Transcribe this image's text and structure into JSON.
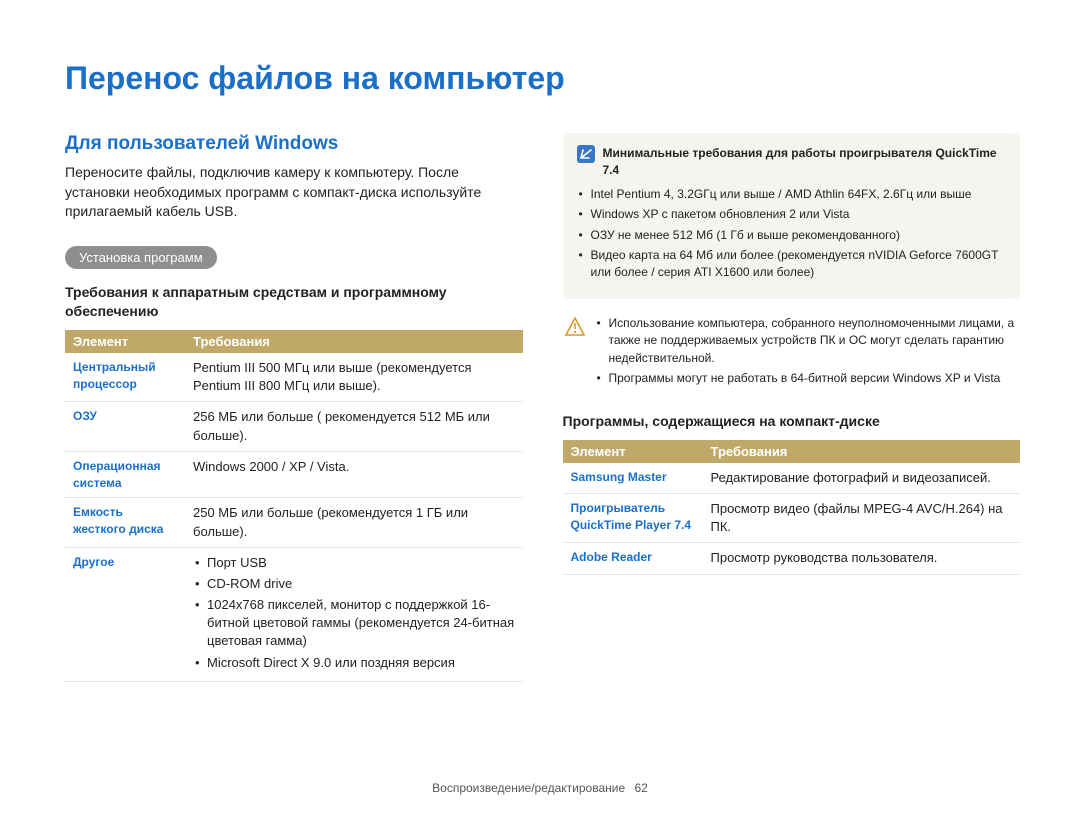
{
  "page_title": "Перенос файлов на компьютер",
  "left": {
    "section_title": "Для пользователей Windows",
    "intro": "Переносите файлы, подключив камеру к компьютеру. После установки необходимых программ с компакт-диска используйте прилагаемый кабель USB.",
    "pill": "Установка программ",
    "subhead": "Требования к аппаратным средствам и программному обеспечению",
    "table": {
      "head1": "Элемент",
      "head2": "Требования",
      "rows": [
        {
          "k": "Центральный процессор",
          "v": "Pentium III 500 МГц или выше (рекомендуется Pentium III 800 МГц или выше)."
        },
        {
          "k": "ОЗУ",
          "v": "256 МБ или больше ( рекомендуется 512 МБ или больше)."
        },
        {
          "k": "Операционная система",
          "v": "Windows 2000 / XP / Vista."
        },
        {
          "k": "Емкость жесткого диска",
          "v": "250 МБ или больше (рекомендуется 1 ГБ или больше)."
        }
      ],
      "other_key": "Другое",
      "other_items": [
        "Порт USB",
        "CD-ROM drive",
        "1024x768 пикселей, монитор с поддержкой 16-битной цветовой гаммы (рекомендуется 24-битная цветовая гамма)",
        "Microsoft Direct X 9.0 или поздняя версия"
      ]
    }
  },
  "right": {
    "note_title": "Минимальные требования для работы проигрывателя QuickTime 7.4",
    "note_items": [
      "Intel Pentium 4, 3.2GГц или выше / AMD Athlin 64FX, 2.6Гц или выше",
      "Windows XP с пакетом обновления 2 или Vista",
      "ОЗУ не менее 512 Мб (1 Гб и выше рекомендованного)",
      "Видео карта на 64 Мб или более (рекомендуется nVIDIA Geforce 7600GT или более / серия ATI X1600 или более)"
    ],
    "warn_items": [
      "Использование компьютера, собранного неуполномоченными лицами, а также не поддерживаемых устройств ПК и ОС могут сделать гарантию недействительной.",
      "Программы могут не работать в 64-битной версии Windows XP и Vista"
    ],
    "subhead": "Программы, содержащиеся на компакт-диске",
    "table": {
      "head1": "Элемент",
      "head2": "Требования",
      "rows": [
        {
          "k": "Samsung Master",
          "v": "Редактирование фотографий и видеозаписей."
        },
        {
          "k": "Проигрыватель QuickTime Player 7.4",
          "v": "Просмотр видео (файлы MPEG-4 AVC/H.264) на ПК."
        },
        {
          "k": "Adobe Reader",
          "v": "Просмотр руководства пользователя."
        }
      ]
    }
  },
  "footer": {
    "section": "Воспроизведение/редактирование",
    "page_num": "62"
  }
}
